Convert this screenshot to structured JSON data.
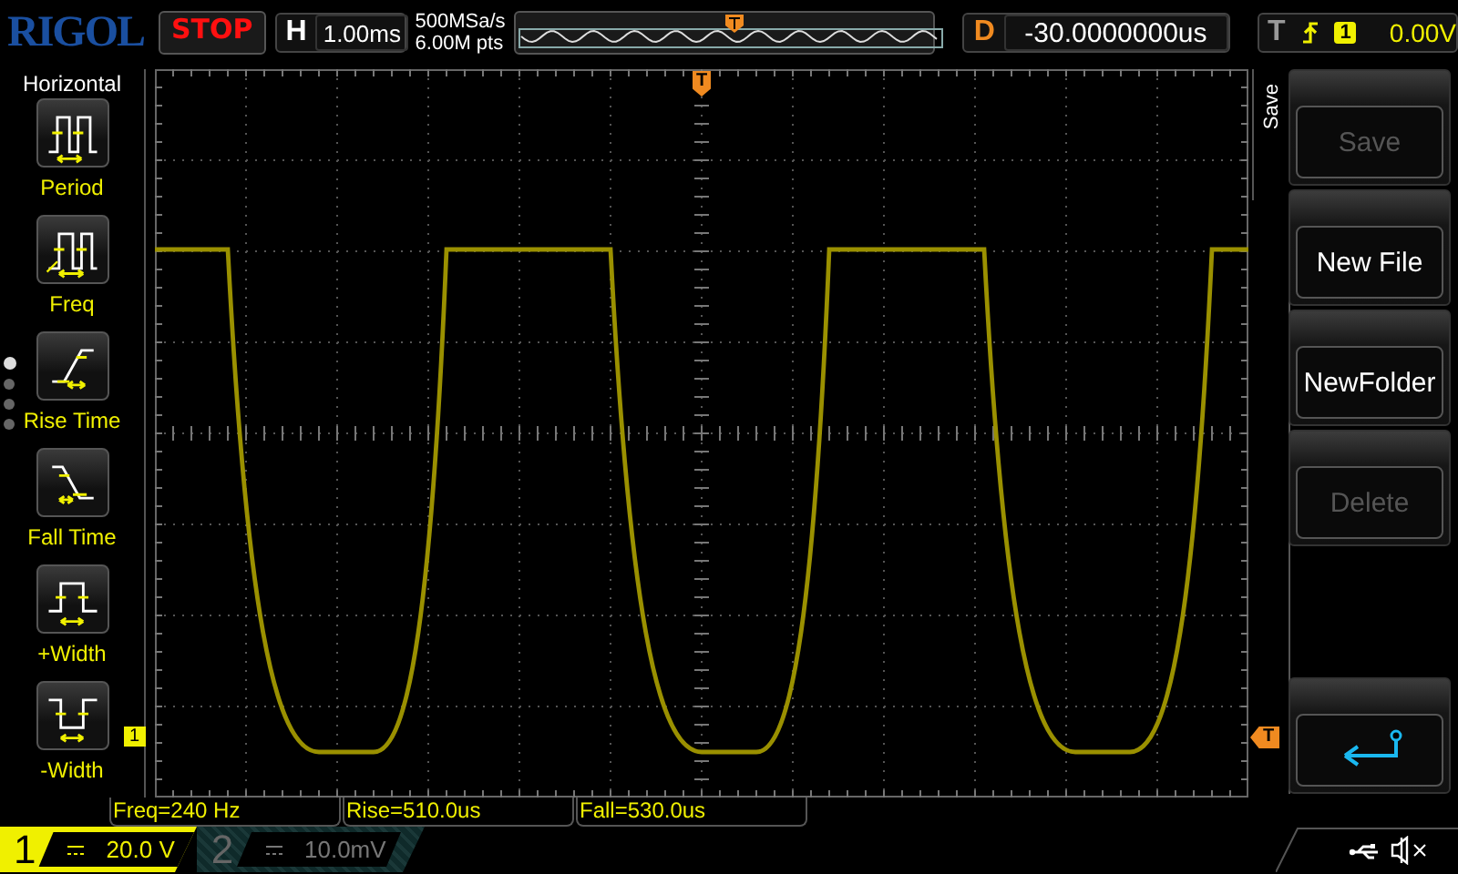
{
  "header": {
    "logo": "RIGOL",
    "run_state": "STOP",
    "timebase": {
      "label": "H",
      "value": "1.00ms"
    },
    "sample_rate": "500MSa/s",
    "memory_depth": "6.00M pts",
    "delay": {
      "label": "D",
      "value": "-30.0000000us"
    },
    "trigger": {
      "label": "T",
      "source": "1",
      "level": "0.00V"
    }
  },
  "measure_menu": {
    "title": "Horizontal",
    "items": [
      {
        "label": "Period",
        "kind": "period"
      },
      {
        "label": "Freq",
        "kind": "freq"
      },
      {
        "label": "Rise Time",
        "kind": "rise"
      },
      {
        "label": "Fall Time",
        "kind": "fall"
      },
      {
        "label": "+Width",
        "kind": "pwidth"
      },
      {
        "label": "-Width",
        "kind": "nwidth"
      }
    ],
    "pages": [
      {
        "selected": true
      },
      {
        "selected": false
      },
      {
        "selected": false
      },
      {
        "selected": false
      }
    ]
  },
  "markers": {
    "trigger_position": "T",
    "trigger_level": "T",
    "channel": "1"
  },
  "softkeys": {
    "title": "Save",
    "buttons": [
      {
        "label": "Save",
        "disabled": true
      },
      {
        "label": "New File",
        "disabled": false
      },
      {
        "label": "NewFolder",
        "disabled": false
      },
      {
        "label": "Delete",
        "disabled": true
      }
    ]
  },
  "measurements": [
    "Freq=240 Hz",
    "Rise=510.0us",
    "Fall=530.0us"
  ],
  "channels": [
    {
      "number": "1",
      "scale": "20.0 V",
      "on": true
    },
    {
      "number": "2",
      "scale": "10.0mV",
      "on": false
    }
  ]
}
